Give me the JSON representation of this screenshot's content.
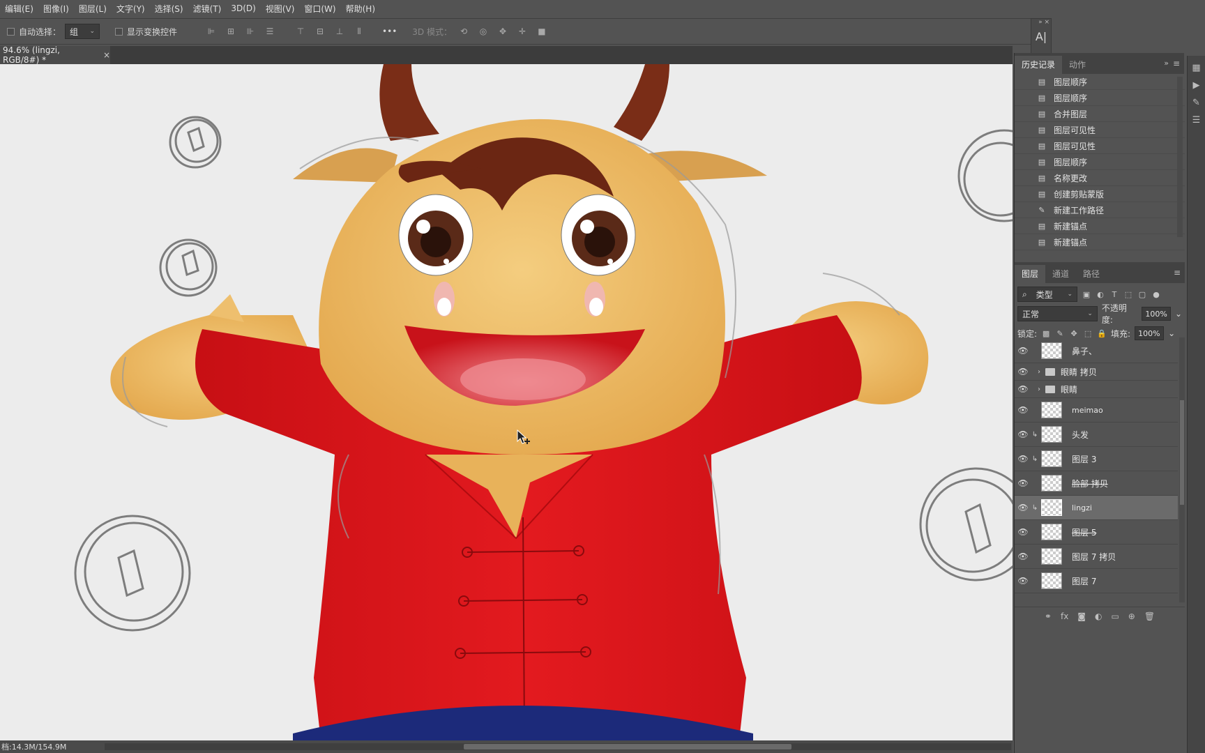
{
  "menu": [
    "编辑(E)",
    "图像(I)",
    "图层(L)",
    "文字(Y)",
    "选择(S)",
    "滤镜(T)",
    "3D(D)",
    "视图(V)",
    "窗口(W)",
    "帮助(H)"
  ],
  "options": {
    "auto_select_label": "自动选择：",
    "auto_select_value": "组",
    "show_transform_label": "显示变换控件",
    "more": "•••",
    "mode_3d": "3D 模式："
  },
  "document_tab": {
    "title": "94.6% (lingzi, RGB/8#) *",
    "close": "×"
  },
  "status": {
    "doc_size": "档:14.3M/154.9M"
  },
  "mini_panel": {
    "icon_text": "A|"
  },
  "history_panel": {
    "tabs": [
      "历史记录",
      "动作"
    ],
    "items": [
      {
        "icon": "document-icon",
        "glyph": "▤",
        "label": "图层顺序"
      },
      {
        "icon": "document-icon",
        "glyph": "▤",
        "label": "图层顺序"
      },
      {
        "icon": "document-icon",
        "glyph": "▤",
        "label": "合并图层"
      },
      {
        "icon": "document-icon",
        "glyph": "▤",
        "label": "图层可见性"
      },
      {
        "icon": "document-icon",
        "glyph": "▤",
        "label": "图层可见性"
      },
      {
        "icon": "document-icon",
        "glyph": "▤",
        "label": "图层顺序"
      },
      {
        "icon": "document-icon",
        "glyph": "▤",
        "label": "名称更改"
      },
      {
        "icon": "document-icon",
        "glyph": "▤",
        "label": "创建剪贴蒙版"
      },
      {
        "icon": "pen-icon",
        "glyph": "✎",
        "label": "新建工作路径"
      },
      {
        "icon": "document-icon",
        "glyph": "▤",
        "label": "新建锚点"
      },
      {
        "icon": "document-icon",
        "glyph": "▤",
        "label": "新建锚点"
      }
    ]
  },
  "layers_panel": {
    "tabs": [
      "图层",
      "通道",
      "路径"
    ],
    "filter_kind": "类型",
    "blend_mode": "正常",
    "opacity_label": "不透明度:",
    "opacity_value": "100%",
    "lock_label": "锁定:",
    "fill_label": "填充:",
    "fill_value": "100%",
    "layers": [
      {
        "name": "鼻子、",
        "type": "layer",
        "clip": false
      },
      {
        "name": "眼睛 拷贝",
        "type": "folder",
        "clip": false
      },
      {
        "name": "眼睛",
        "type": "folder",
        "clip": false
      },
      {
        "name": "meimao",
        "type": "layer",
        "clip": false
      },
      {
        "name": "头发",
        "type": "layer",
        "clip": true
      },
      {
        "name": "图层 3",
        "type": "layer",
        "clip": true
      },
      {
        "name": "脸部 拷贝",
        "type": "layer",
        "clip": false
      },
      {
        "name": "lingzi",
        "type": "layer",
        "clip": true,
        "selected": true
      },
      {
        "name": "图层 5",
        "type": "layer",
        "clip": false
      },
      {
        "name": "图层 7 拷贝",
        "type": "layer",
        "clip": false
      },
      {
        "name": "图层 7",
        "type": "layer",
        "clip": false
      }
    ]
  },
  "colors": {
    "ui_bg": "#535353",
    "canvas_bg": "#ececec",
    "shirt": "#d8141a",
    "skin": "#eebf6e",
    "horn": "#7a2d17",
    "hair": "#6b2613"
  }
}
